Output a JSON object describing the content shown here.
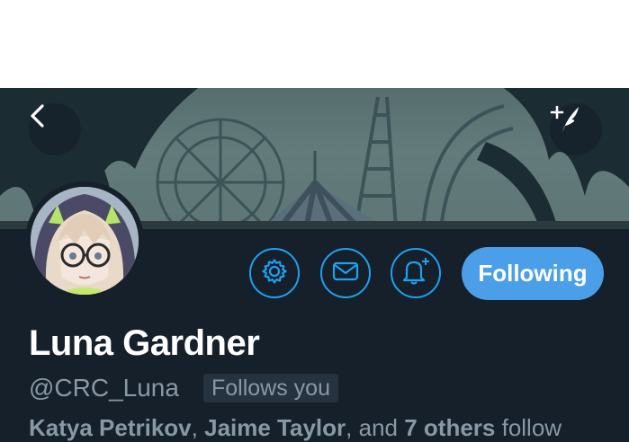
{
  "profile": {
    "display_name": "Luna Gardner",
    "handle": "@CRC_Luna",
    "follows_you_badge": "Follows you",
    "followed_by": {
      "user_1": "Katya Petrikov",
      "separator": ", ",
      "user_2": "Jaime Taylor",
      "and_text": ", and ",
      "others": "7 others",
      "suffix": " follow"
    }
  },
  "actions": {
    "following_label": "Following"
  },
  "icons": {
    "back": "chevron-left-icon",
    "compose": "compose-feather-icon",
    "settings": "gear-icon",
    "message": "envelope-icon",
    "notify": "bell-plus-icon"
  },
  "colors": {
    "background": "#15202b",
    "accent": "#1da1f2",
    "button_fill": "#4a9fe8",
    "secondary_text": "#8899a6"
  }
}
